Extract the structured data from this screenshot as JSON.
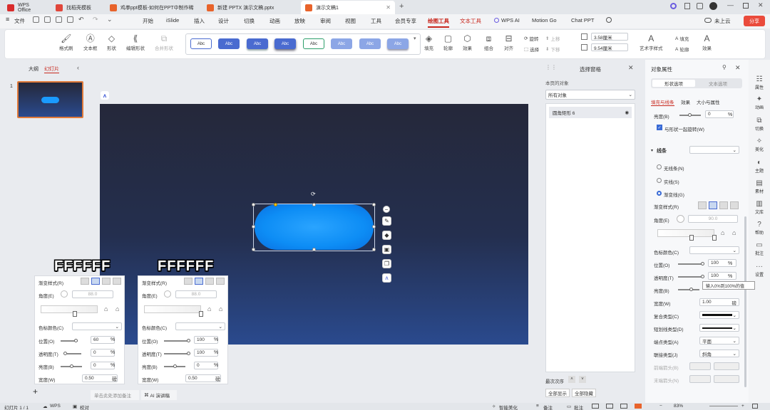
{
  "tabs": [
    {
      "label": "WPS Office",
      "color": "#d92c2c"
    },
    {
      "label": "找稻壳模板",
      "color": "#e0463a"
    },
    {
      "label": "鸡拳ppt模板-如何在PPT中制作稀",
      "color": "#e8632b"
    },
    {
      "label": "新建 PPTX 演示文稿.pptx",
      "color": "#e8632b"
    },
    {
      "label": "演示文稿1",
      "color": "#e8632b"
    }
  ],
  "titlebar": {
    "cloud": "未上云",
    "share": "分享"
  },
  "menus": [
    "文件",
    "开始",
    "iSlide",
    "插入",
    "设计",
    "切换",
    "动画",
    "放映",
    "审阅",
    "视图",
    "工具",
    "会员专享",
    "绘图工具",
    "文本工具",
    "WPS AI",
    "Motion Go",
    "Chat PPT"
  ],
  "ribbon": {
    "format_painter": "格式刷",
    "textbox": "文本框",
    "shape": "形状",
    "edit_shape": "编辑形状",
    "merge_shape": "合并形状",
    "style_label": "Abc",
    "fill": "填充",
    "outline": "轮廓",
    "effect": "效果",
    "group": "组合",
    "align": "对齐",
    "rotate": "旋转",
    "up": "上移",
    "down": "下移",
    "select": "选择",
    "height": "3.58厘米",
    "width": "9.54厘米",
    "art_text": "艺术字样式",
    "t_fill": "填充",
    "t_outline": "轮廓",
    "t_effect": "效果"
  },
  "leftpanel": {
    "outline_tab": "大纲",
    "slide_tab": "幻灯片",
    "slide_num": "1"
  },
  "notes": {
    "placeholder": "单击此处添加备注",
    "ai": "AI 演讲稿"
  },
  "overlay": {
    "label": "FFFFFF"
  },
  "gradpanel1": {
    "gradient_style": "渐变样式(R)",
    "angle": "角度(E)",
    "angle_val": "88.0",
    "stop_color": "色标颜色(C)",
    "position": "位置(O)",
    "position_val": "60",
    "transparency": "透明度(T)",
    "transparency_val": "0",
    "brightness": "亮度(B)",
    "brightness_val": "0",
    "width": "宽度(W)",
    "width_val": "0.50",
    "unit_pt": "磅",
    "pct": "%"
  },
  "gradpanel2": {
    "gradient_style": "渐变样式(R)",
    "angle": "角度(E)",
    "angle_val": "88.0",
    "stop_color": "色标颜色(C)",
    "position": "位置(O)",
    "position_val": "100",
    "transparency": "透明度(T)",
    "transparency_val": "100",
    "brightness": "亮度(B)",
    "brightness_val": "0",
    "width": "宽度(W)",
    "width_val": "0.50",
    "unit_pt": "磅",
    "pct": "%"
  },
  "selpane": {
    "title": "选择窗格",
    "page_objects": "本页的对象",
    "all_objects": "所有对象",
    "item": "圆角矩形 6",
    "order": "最次次序",
    "show_all": "全部显示",
    "hide_all": "全部隐藏"
  },
  "props": {
    "title": "对象属性",
    "tab_shape": "形状选项",
    "tab_text": "文本选项",
    "sub_fill": "填充与线条",
    "sub_effect": "效果",
    "sub_size": "大小与属性",
    "brightness": "亮度(B)",
    "brightness_val": "0",
    "rotate_with": "与形状一起旋转(W)",
    "line": "线条",
    "no_line": "无线条(N)",
    "solid": "实线(S)",
    "gradient": "渐变线(G)",
    "gradient_style": "渐变样式(R)",
    "angle": "角度(E)",
    "angle_val": "90.0",
    "stop_color": "色标颜色(C)",
    "position": "位置(O)",
    "position_val": "100",
    "transparency": "透明度(T)",
    "transparency_val": "100",
    "tooltip": "输入0%到100%的值",
    "brightness2": "亮度(B)",
    "width": "宽度(W)",
    "width_val": "1.00",
    "unit": "磅",
    "compound": "复合类型(C)",
    "dash": "短划线类型(D)",
    "cap": "端点类型(A)",
    "cap_val": "平面",
    "join": "联接类型(J)",
    "join_val": "斜角",
    "begin_arrow": "前端箭头(B)",
    "end_arrow": "末端箭头(N)",
    "pct": "%"
  },
  "rside": [
    "属性",
    "动画",
    "切换",
    "美化",
    "主题",
    "素材",
    "文库",
    "帮助",
    "批注",
    "设置"
  ],
  "status": {
    "slide": "幻灯片 1 / 1",
    "wps": "WPS",
    "proof": "校对",
    "beautify": "智能美化",
    "notes": "备注",
    "comments": "批注",
    "zoom": "83%"
  }
}
